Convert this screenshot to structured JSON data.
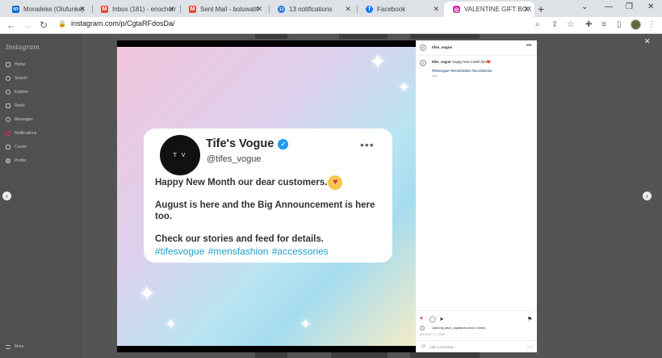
{
  "browser": {
    "tabs": [
      {
        "title": "Moradeke (Olufunke)",
        "icon": "linkedin-icon",
        "color": "#0a66c2",
        "glyph": "in"
      },
      {
        "title": "Inbox (181) - enochom",
        "icon": "gmail-icon",
        "color": "#ea4335",
        "glyph": "M"
      },
      {
        "title": "Sent Mail - boluwatif",
        "icon": "gmail-icon",
        "color": "#ea4335",
        "glyph": "M"
      },
      {
        "title": "13 notifications",
        "icon": "notification-badge-icon",
        "color": "#1a73e8",
        "glyph": "13"
      },
      {
        "title": "Facebook",
        "icon": "facebook-icon",
        "color": "#1877f2",
        "glyph": "f"
      },
      {
        "title": "VALENTINE GIFT BOX",
        "icon": "instagram-icon",
        "color": "#d6249f",
        "glyph": "◎"
      }
    ],
    "url": "instagram.com/p/CgtaRFdosDa/"
  },
  "instagram": {
    "logo": "Instagram",
    "nav": [
      "Home",
      "Search",
      "Explore",
      "Reels",
      "Messages",
      "Notifications",
      "Create",
      "Profile"
    ],
    "more": "More"
  },
  "post": {
    "image_card": {
      "name": "Tife's Vogue",
      "handle": "@tifes_vogue",
      "logo_text": "T V",
      "line1": "Happy New Month our dear customers.",
      "line2": "August is here and the Big Announcement is here too.",
      "line3": "Check our stories and feed for details.",
      "hashtags": "#tifesvogue #mensfashion #accessories",
      "verified_color": "#1d9bf0",
      "hashtag_color": "#1da1c7"
    },
    "panel": {
      "username": "tifes_vogue",
      "caption": "Happy New month fam❤️",
      "hashtags": "#tifesvogue #mensfashion #accessories",
      "time": "19w",
      "likes_text": "Liked by jmax_signature and 4 others",
      "date": "AUGUST 1, 2022",
      "comment_placeholder": "Add a comment…",
      "post_label": "Post"
    }
  }
}
